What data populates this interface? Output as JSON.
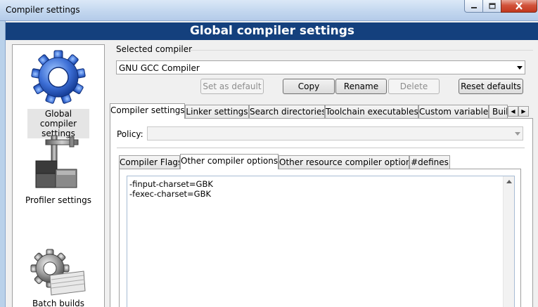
{
  "window": {
    "title": "Compiler settings",
    "controls": {
      "minimize_icon": "minimize-icon",
      "maximize_icon": "maximize-icon",
      "close_icon": "close-icon"
    }
  },
  "header": {
    "title": "Global compiler settings"
  },
  "categories": [
    {
      "label": "Global compiler settings",
      "icon": "gear-icon",
      "selected": true
    },
    {
      "label": "Profiler settings",
      "icon": "profiler-icon",
      "selected": false
    },
    {
      "label": "Batch builds",
      "icon": "batch-builds-icon",
      "selected": false
    }
  ],
  "selected_compiler": {
    "label": "Selected compiler",
    "value": "GNU GCC Compiler"
  },
  "buttons": {
    "set_as_default": "Set as default",
    "copy": "Copy",
    "rename": "Rename",
    "delete": "Delete",
    "reset_defaults": "Reset defaults"
  },
  "main_tabs": [
    "Compiler settings",
    "Linker settings",
    "Search directories",
    "Toolchain executables",
    "Custom variables",
    "Buil"
  ],
  "policy": {
    "label": "Policy:",
    "value": ""
  },
  "sub_tabs": [
    "Compiler Flags",
    "Other compiler options",
    "Other resource compiler options",
    "#defines"
  ],
  "editor": {
    "lines": [
      "-finput-charset=GBK",
      "-fexec-charset=GBK"
    ]
  },
  "colors": {
    "header_bg": "#14407d",
    "window_frame": "#b9d1ea",
    "close_button": "#c2381f"
  }
}
